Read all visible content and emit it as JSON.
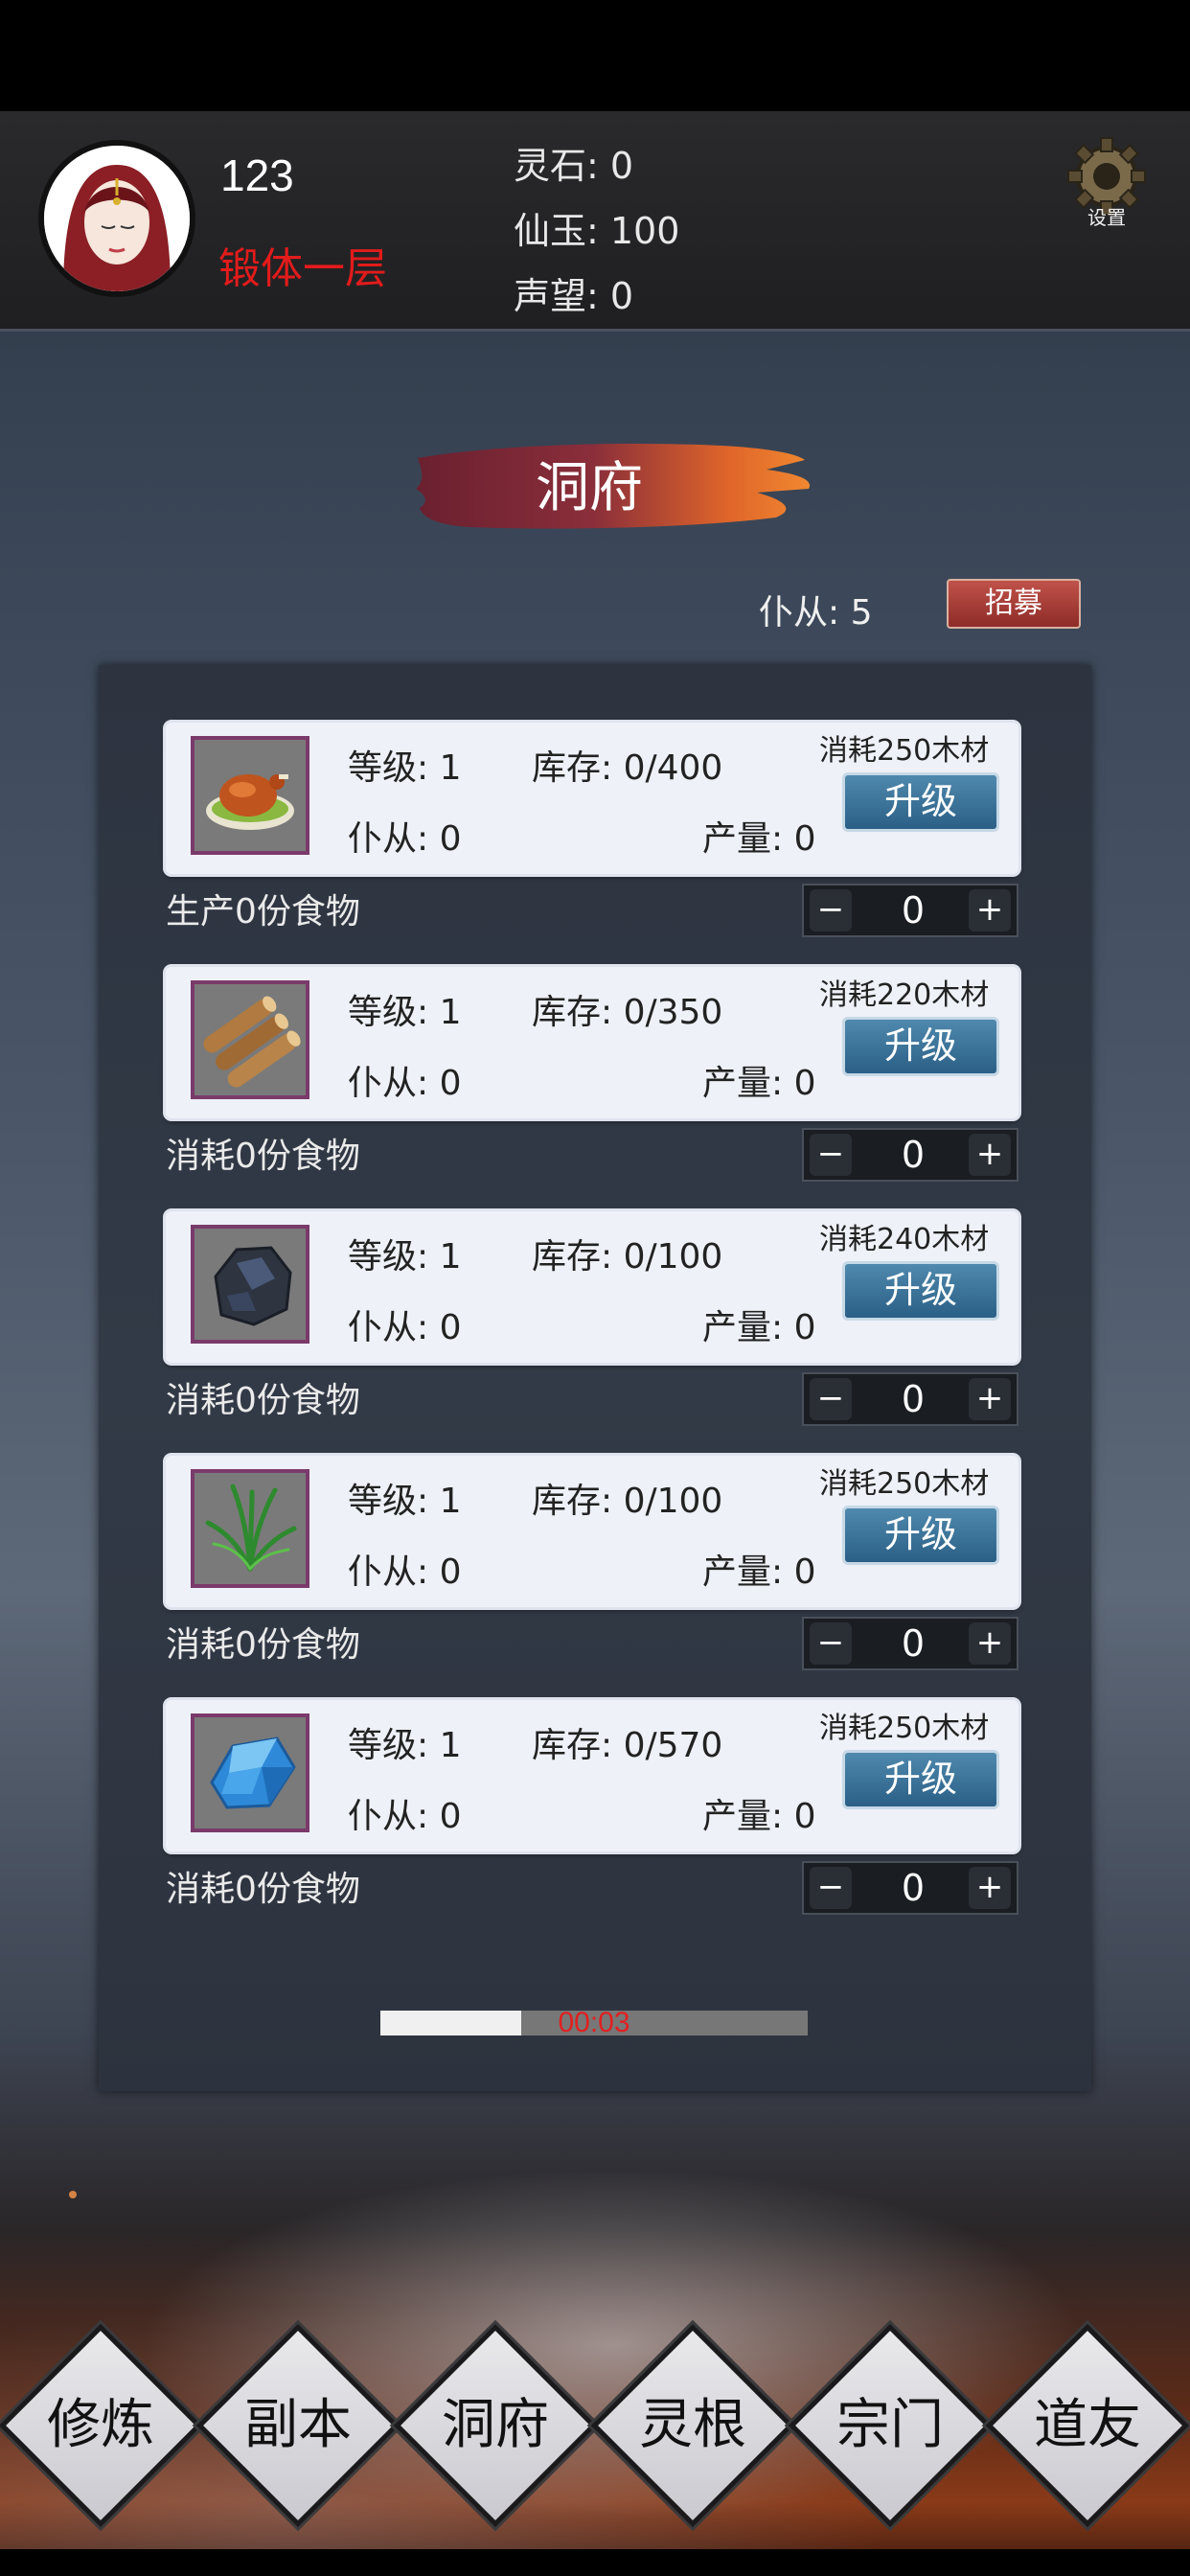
{
  "header": {
    "player_name": "123",
    "realm": "锻体一层",
    "resources": [
      {
        "label": "灵石",
        "value": "0",
        "text": "灵石: 0"
      },
      {
        "label": "仙玉",
        "value": "100",
        "text": "仙玉: 100"
      },
      {
        "label": "声望",
        "value": "0",
        "text": "声望: 0"
      }
    ],
    "settings_label": "设置"
  },
  "page": {
    "title": "洞府",
    "servant_count": "仆从: 5",
    "recruit_label": "招募"
  },
  "buildings": [
    {
      "icon": "roast-chicken-icon",
      "level": "等级: 1",
      "stock": "库存: 0/400",
      "cost": "消耗250木材",
      "servants": "仆从: 0",
      "output": "产量: 0",
      "upgrade": "升级",
      "produce": "生产0份食物",
      "count": "0"
    },
    {
      "icon": "wood-logs-icon",
      "level": "等级: 1",
      "stock": "库存: 0/350",
      "cost": "消耗220木材",
      "servants": "仆从: 0",
      "output": "产量: 0",
      "upgrade": "升级",
      "produce": "消耗0份食物",
      "count": "0"
    },
    {
      "icon": "ore-stone-icon",
      "level": "等级: 1",
      "stock": "库存: 0/100",
      "cost": "消耗240木材",
      "servants": "仆从: 0",
      "output": "产量: 0",
      "upgrade": "升级",
      "produce": "消耗0份食物",
      "count": "0"
    },
    {
      "icon": "herb-grass-icon",
      "level": "等级: 1",
      "stock": "库存: 0/100",
      "cost": "消耗250木材",
      "servants": "仆从: 0",
      "output": "产量: 0",
      "upgrade": "升级",
      "produce": "消耗0份食物",
      "count": "0"
    },
    {
      "icon": "blue-crystal-icon",
      "level": "等级: 1",
      "stock": "库存: 0/570",
      "cost": "消耗250木材",
      "servants": "仆从: 0",
      "output": "产量: 0",
      "upgrade": "升级",
      "produce": "消耗0份食物",
      "count": "0"
    }
  ],
  "stepper_symbols": {
    "minus": "−",
    "plus": "+"
  },
  "progress": {
    "fraction": 0.33,
    "time": "00:03"
  },
  "nav": [
    "修炼",
    "副本",
    "洞府",
    "灵根",
    "宗门",
    "道友"
  ],
  "colors": {
    "realm": "#e21b1b",
    "timer": "#e02020",
    "upgrade_button": "#2b5f86",
    "recruit_button": "#8e2c28"
  }
}
